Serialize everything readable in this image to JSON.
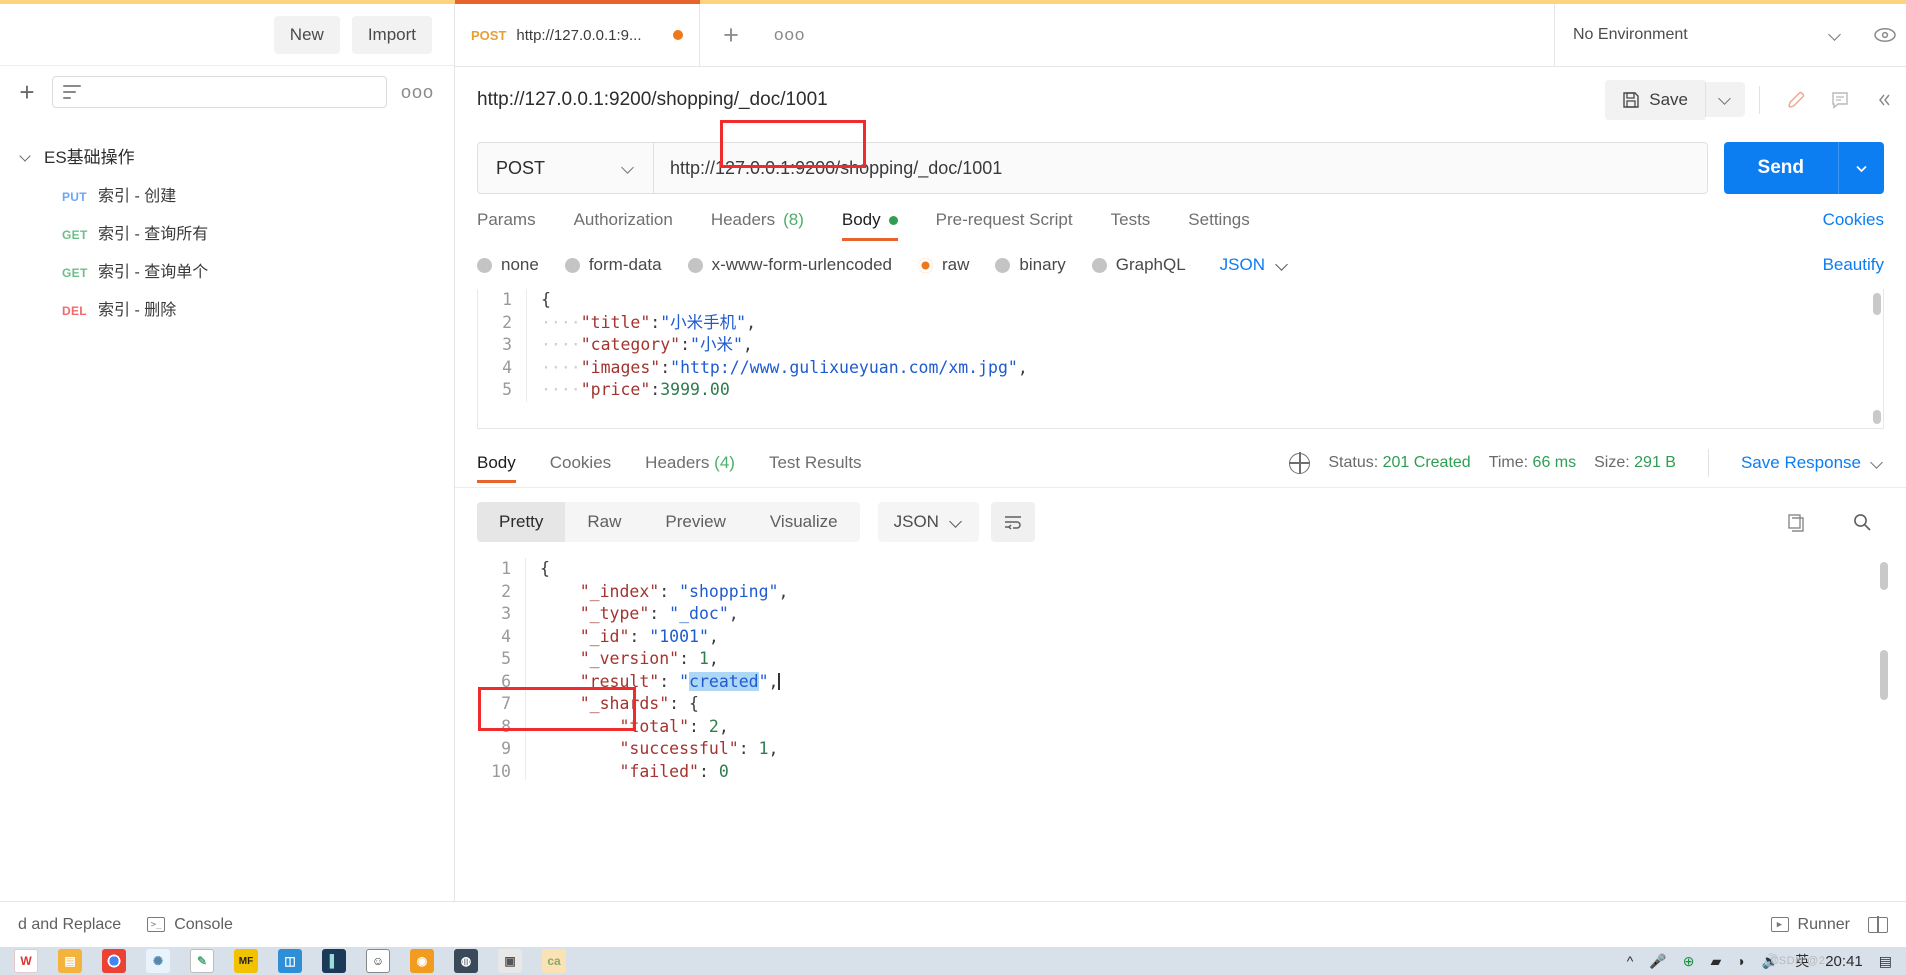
{
  "sidebar": {
    "new_label": "New",
    "import_label": "Import",
    "search_placeholder": "",
    "more_icon": "ooo",
    "collection": {
      "name": "ES基础操作",
      "requests": [
        {
          "method": "PUT",
          "name": "索引 - 创建"
        },
        {
          "method": "GET",
          "name": "索引 - 查询所有"
        },
        {
          "method": "GET",
          "name": "索引 - 查询单个"
        },
        {
          "method": "DEL",
          "name": "索引 - 删除"
        }
      ]
    }
  },
  "tabstrip": {
    "tab": {
      "method": "POST",
      "title": "http://127.0.0.1:9...",
      "unsaved": true
    },
    "new_tab_icon": "+",
    "more_icon": "ooo",
    "environment": "No Environment"
  },
  "request": {
    "title": "http://127.0.0.1:9200/shopping/_doc/1001",
    "save_label": "Save",
    "method": "POST",
    "url": "http://127.0.0.1:9200/shopping/_doc/1001",
    "send_label": "Send",
    "tabs": [
      {
        "label": "Params",
        "active": false
      },
      {
        "label": "Authorization",
        "active": false
      },
      {
        "label": "Headers",
        "count": "(8)",
        "active": false
      },
      {
        "label": "Body",
        "active": true,
        "dot": true
      },
      {
        "label": "Pre-request Script",
        "active": false
      },
      {
        "label": "Tests",
        "active": false
      },
      {
        "label": "Settings",
        "active": false
      }
    ],
    "cookies_link": "Cookies",
    "body_types": [
      {
        "label": "none",
        "selected": false
      },
      {
        "label": "form-data",
        "selected": false
      },
      {
        "label": "x-www-form-urlencoded",
        "selected": false
      },
      {
        "label": "raw",
        "selected": true
      },
      {
        "label": "binary",
        "selected": false
      },
      {
        "label": "GraphQL",
        "selected": false
      }
    ],
    "body_format": "JSON",
    "beautify_label": "Beautify",
    "body_lines": [
      {
        "n": "1",
        "tokens": [
          {
            "t": "{",
            "c": "p"
          }
        ]
      },
      {
        "n": "2",
        "tokens": [
          {
            "t": "····",
            "c": "ind"
          },
          {
            "t": "\"title\"",
            "c": "k"
          },
          {
            "t": ":",
            "c": "p"
          },
          {
            "t": "\"小米手机\"",
            "c": "s"
          },
          {
            "t": ",",
            "c": "p"
          }
        ]
      },
      {
        "n": "3",
        "tokens": [
          {
            "t": "····",
            "c": "ind"
          },
          {
            "t": "\"category\"",
            "c": "k"
          },
          {
            "t": ":",
            "c": "p"
          },
          {
            "t": "\"小米\"",
            "c": "s"
          },
          {
            "t": ",",
            "c": "p"
          }
        ]
      },
      {
        "n": "4",
        "tokens": [
          {
            "t": "····",
            "c": "ind"
          },
          {
            "t": "\"images\"",
            "c": "k"
          },
          {
            "t": ":",
            "c": "p"
          },
          {
            "t": "\"http://www.gulixueyuan.com/xm.jpg\"",
            "c": "s"
          },
          {
            "t": ",",
            "c": "p"
          }
        ]
      },
      {
        "n": "5",
        "tokens": [
          {
            "t": "····",
            "c": "ind"
          },
          {
            "t": "\"price\"",
            "c": "k"
          },
          {
            "t": ":",
            "c": "p"
          },
          {
            "t": "3999.00",
            "c": "n"
          }
        ]
      }
    ]
  },
  "response": {
    "tabs": [
      {
        "label": "Body",
        "active": true
      },
      {
        "label": "Cookies",
        "active": false
      },
      {
        "label": "Headers",
        "count": "(4)",
        "active": false
      },
      {
        "label": "Test Results",
        "active": false
      }
    ],
    "status_label": "Status:",
    "status_value": "201 Created",
    "time_label": "Time:",
    "time_value": "66 ms",
    "size_label": "Size:",
    "size_value": "291 B",
    "save_response_label": "Save Response",
    "view_modes": [
      {
        "label": "Pretty",
        "active": true
      },
      {
        "label": "Raw",
        "active": false
      },
      {
        "label": "Preview",
        "active": false
      },
      {
        "label": "Visualize",
        "active": false
      }
    ],
    "format": "JSON",
    "body_lines": [
      {
        "n": "1",
        "tokens": [
          {
            "t": "{",
            "c": "p"
          }
        ]
      },
      {
        "n": "2",
        "tokens": [
          {
            "t": "    ",
            "c": "p"
          },
          {
            "t": "\"_index\"",
            "c": "k"
          },
          {
            "t": ": ",
            "c": "p"
          },
          {
            "t": "\"shopping\"",
            "c": "s"
          },
          {
            "t": ",",
            "c": "p"
          }
        ]
      },
      {
        "n": "3",
        "tokens": [
          {
            "t": "    ",
            "c": "p"
          },
          {
            "t": "\"_type\"",
            "c": "k"
          },
          {
            "t": ": ",
            "c": "p"
          },
          {
            "t": "\"_doc\"",
            "c": "s"
          },
          {
            "t": ",",
            "c": "p"
          }
        ]
      },
      {
        "n": "4",
        "tokens": [
          {
            "t": "    ",
            "c": "p"
          },
          {
            "t": "\"_id\"",
            "c": "k"
          },
          {
            "t": ": ",
            "c": "p"
          },
          {
            "t": "\"1001\"",
            "c": "s"
          },
          {
            "t": ",",
            "c": "p"
          }
        ]
      },
      {
        "n": "5",
        "tokens": [
          {
            "t": "    ",
            "c": "p"
          },
          {
            "t": "\"_version\"",
            "c": "k"
          },
          {
            "t": ": ",
            "c": "p"
          },
          {
            "t": "1",
            "c": "n"
          },
          {
            "t": ",",
            "c": "p"
          }
        ]
      },
      {
        "n": "6",
        "tokens": [
          {
            "t": "    ",
            "c": "p"
          },
          {
            "t": "\"result\"",
            "c": "k"
          },
          {
            "t": ": ",
            "c": "p"
          },
          {
            "t": "\"",
            "c": "s"
          },
          {
            "t": "created",
            "c": "s sel-hl"
          },
          {
            "t": "\"",
            "c": "s"
          },
          {
            "t": ",",
            "c": "p"
          }
        ]
      },
      {
        "n": "7",
        "tokens": [
          {
            "t": "    ",
            "c": "p"
          },
          {
            "t": "\"_shards\"",
            "c": "k"
          },
          {
            "t": ": ",
            "c": "p"
          },
          {
            "t": "{",
            "c": "p"
          }
        ]
      },
      {
        "n": "8",
        "tokens": [
          {
            "t": "        ",
            "c": "p"
          },
          {
            "t": "\"total\"",
            "c": "k"
          },
          {
            "t": ": ",
            "c": "p"
          },
          {
            "t": "2",
            "c": "n"
          },
          {
            "t": ",",
            "c": "p"
          }
        ]
      },
      {
        "n": "9",
        "tokens": [
          {
            "t": "        ",
            "c": "p"
          },
          {
            "t": "\"successful\"",
            "c": "k"
          },
          {
            "t": ": ",
            "c": "p"
          },
          {
            "t": "1",
            "c": "n"
          },
          {
            "t": ",",
            "c": "p"
          }
        ]
      },
      {
        "n": "10",
        "tokens": [
          {
            "t": "        ",
            "c": "p"
          },
          {
            "t": "\"failed\"",
            "c": "k"
          },
          {
            "t": ": ",
            "c": "p"
          },
          {
            "t": "0",
            "c": "n"
          }
        ]
      }
    ]
  },
  "statusbar": {
    "find_replace": "d and Replace",
    "console": "Console",
    "runner": "Runner"
  },
  "taskbar": {
    "clock": "20:41",
    "ime": "英",
    "watermark": "CSDN @2..."
  },
  "colors": {
    "accent_orange": "#e8622b",
    "send_blue": "#0d7df2",
    "status_green": "#2e9e52",
    "annotation_red": "#ef2b2b"
  }
}
